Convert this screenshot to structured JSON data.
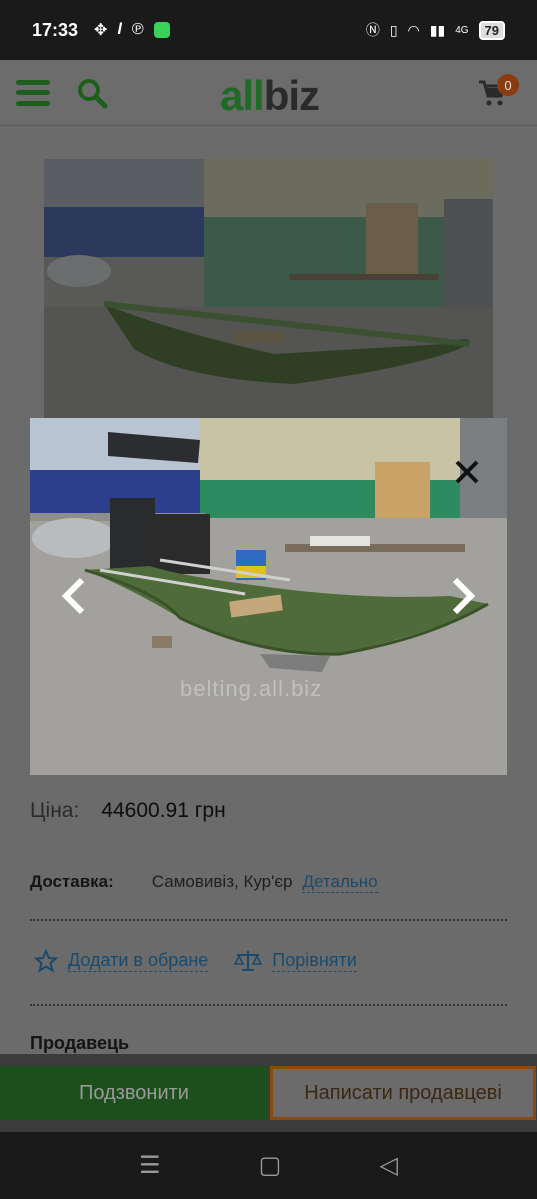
{
  "status_bar": {
    "time": "17:33",
    "battery": "79",
    "network_label": "4G"
  },
  "header": {
    "logo_part1": "all",
    "logo_part2": "biz",
    "cart_count": "0"
  },
  "product": {
    "price_label": "Ціна:",
    "price_value": "44600.91 грн",
    "delivery_label": "Доставка:",
    "delivery_value": "Самовивіз,  Кур'єр",
    "delivery_link": "Детально",
    "favorite_label": "Додати в обране",
    "compare_label": "Порівняти",
    "seller_label": "Продавець"
  },
  "lightbox": {
    "watermark": "belting.all.biz"
  },
  "bottom_bar": {
    "call_label": "Подзвонити",
    "write_label": "Написати продавцеві"
  },
  "colors": {
    "brand_green": "#1f6a24",
    "link_blue": "#1a4a6b",
    "accent_orange": "#8a4a12"
  }
}
